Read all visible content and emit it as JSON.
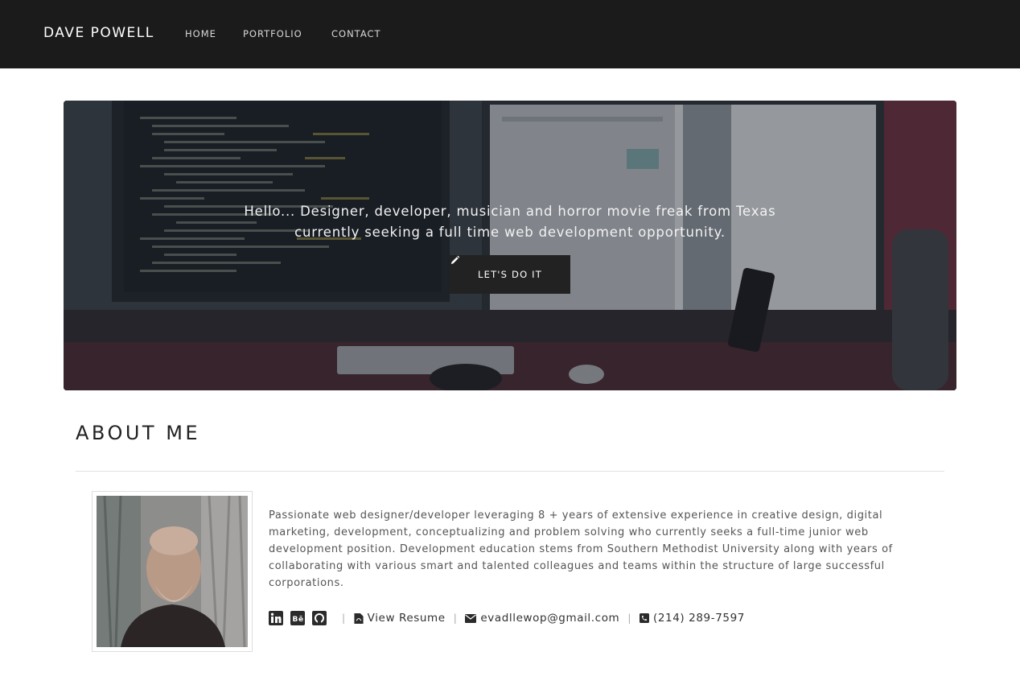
{
  "navbar": {
    "brand": "DAVE POWELL",
    "links": [
      "HOME",
      "PORTFOLIO",
      "CONTACT"
    ]
  },
  "hero": {
    "tagline": "Hello... Designer, developer, musician and horror movie freak from Texas currently seeking a full time web development opportunity.",
    "cta_label": "LET'S DO IT",
    "cta_icon": "pencil-icon"
  },
  "about": {
    "title": "ABOUT ME",
    "bio": "Passionate web designer/developer leveraging 8 + years of extensive experience in creative design, digital marketing, development, conceptualizing and problem solving who currently seeks a full-time junior web development position. Development education stems from Southern Methodist University along with years of collaborating with various smart and talented colleagues and teams within the structure of large successful corporations.",
    "social_icons": [
      "linkedin-icon",
      "behance-icon",
      "github-icon"
    ],
    "separator": "|",
    "resume_label": "View Resume",
    "email": "evadllewop@gmail.com",
    "phone": "(214) 289-7597"
  },
  "colors": {
    "navbar_bg": "#1b1b1b",
    "cta_bg": "#222222",
    "text": "#555555"
  }
}
